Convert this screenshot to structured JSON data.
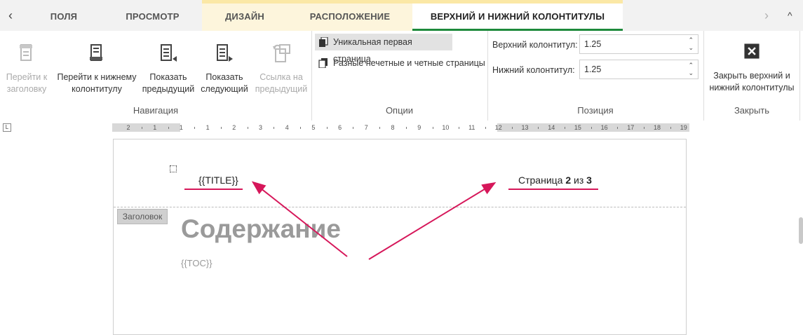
{
  "tabs": {
    "left_arrow": "‹",
    "right_arrow": "›",
    "collapse": "^",
    "items": [
      {
        "label": "ПОЛЯ"
      },
      {
        "label": "ПРОСМОТР"
      },
      {
        "label": "ДИЗАЙН"
      },
      {
        "label": "РАСПОЛОЖЕНИЕ"
      },
      {
        "label": "ВЕРХНИЙ И НИЖНИЙ КОЛОНТИТУЛЫ"
      }
    ]
  },
  "ribbon": {
    "navigation": {
      "title": "Навигация",
      "buttons": [
        {
          "label": "Перейти к заголовку",
          "icon": "go-to-header-icon",
          "enabled": false
        },
        {
          "label": "Перейти к нижнему колонтитулу",
          "icon": "go-to-footer-icon",
          "enabled": true
        },
        {
          "label": "Показать предыдущий",
          "icon": "show-previous-icon",
          "enabled": true
        },
        {
          "label": "Показать следующий",
          "icon": "show-next-icon",
          "enabled": true
        },
        {
          "label": "Ссылка на предыдущий",
          "icon": "link-to-previous-icon",
          "enabled": false
        }
      ]
    },
    "options": {
      "title": "Опции",
      "first_page": "Уникальная первая страница",
      "odd_even": "Разные нечетные и четные страницы"
    },
    "position": {
      "title": "Позиция",
      "header_label": "Верхний колонтитул:",
      "header_value": "1.25",
      "footer_label": "Нижний колонтитул:",
      "footer_value": "1.25"
    },
    "close": {
      "title": "Закрыть",
      "button": "Закрыть верхний и нижний колонтитулы",
      "icon": "close-icon"
    }
  },
  "ruler": {
    "corner": "L",
    "numbers": [
      "2",
      "1",
      "1",
      "1",
      "2",
      "3",
      "4",
      "5",
      "6",
      "7",
      "8",
      "9",
      "10",
      "11",
      "12",
      "13",
      "14",
      "15",
      "16",
      "17",
      "18",
      "19"
    ]
  },
  "document": {
    "header_title": "{{TITLE}}",
    "page_prefix": "Страница ",
    "page_current": "2",
    "page_middle": " из ",
    "page_total": "3",
    "header_tag": "Заголовок",
    "heading": "Содержание",
    "toc": "{{TOC}}"
  },
  "colors": {
    "annotation": "#d6175a",
    "active_tab_underline": "#1e8a3c",
    "context_tab_bg": "#fdf5dc"
  }
}
